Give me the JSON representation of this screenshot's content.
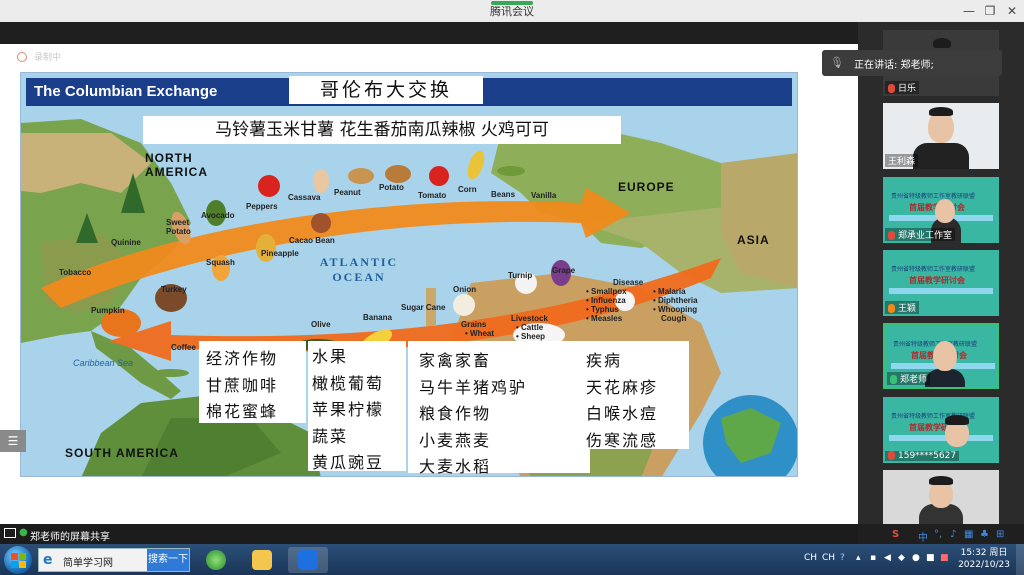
{
  "window": {
    "title": "腾讯会议",
    "controls": {
      "minimize": "—",
      "restore": "❐",
      "close": "✕"
    }
  },
  "share": {
    "recording_label": "录制中",
    "side_handle": "☰"
  },
  "slide": {
    "title_en": "The Columbian Exchange",
    "title_cn": "哥伦布大交换",
    "top_banner": "马铃薯玉米甘薯 花生番茄南瓜辣椒 火鸡可可",
    "regions": {
      "north_america": "NORTH AMERICA",
      "europe": "EUROPE",
      "asia": "ASIA",
      "south_america": "SOUTH AMERICA",
      "ocean": "ATLANTIC OCEAN",
      "sea": "Caribbean Sea"
    },
    "items": {
      "peppers": "Peppers",
      "cassava": "Cassava",
      "peanut": "Peanut",
      "potato": "Potato",
      "corn": "Corn",
      "tomato": "Tomato",
      "beans": "Beans",
      "vanilla": "Vanilla",
      "avocado": "Avocado",
      "sweet_potato": "Sweet Potato",
      "quinine": "Quinine",
      "cacao": "Cacao Bean",
      "squash": "Squash",
      "pineapple": "Pineapple",
      "tobacco": "Tobacco",
      "turkey": "Turkey",
      "pumpkin": "Pumpkin",
      "turnip": "Turnip",
      "grape": "Grape",
      "onion": "Onion",
      "sugar_cane": "Sugar Cane",
      "olive": "Olive",
      "banana": "Banana",
      "coffee": "Coffee",
      "grains": "Grains",
      "wheat": "• Wheat",
      "livestock": "Livestock",
      "cattle": "• Cattle",
      "sheep": "• Sheep",
      "disease": "Disease",
      "smallpox": "• Smallpox",
      "influenza": "• Influenza",
      "typhus": "• Typhus",
      "measles": "• Measles",
      "malaria": "• Malaria",
      "diphtheria": "• Diphtheria",
      "whooping": "• Whooping",
      "cough": "Cough"
    },
    "cn_lines": {
      "col1": [
        "经济作物",
        "甘蔗咖啡",
        "棉花蜜蜂"
      ],
      "col2": [
        "水果",
        "橄榄葡萄",
        "苹果柠檬",
        "蔬菜",
        "黄瓜豌豆"
      ],
      "col3": [
        "家禽家畜",
        "马牛羊猪鸡驴",
        "粮食作物",
        "小麦燕麦",
        "大麦水稻"
      ],
      "col4": [
        "疾病",
        "天花麻疹",
        "白喉水痘",
        "伤寒流感"
      ]
    }
  },
  "panel": {
    "speaking_label": "正在讲话: 郑老师;",
    "participants": [
      {
        "name": "日乐"
      },
      {
        "name": "王利森"
      },
      {
        "name": "郑承业工作室"
      },
      {
        "name": "王颖"
      },
      {
        "name": "郑老师"
      },
      {
        "name": "159****5627"
      },
      {
        "name": ""
      }
    ],
    "poster_line1": "贵州省特级教师工作室教研联盟",
    "poster_line2": "首届教学研讨会"
  },
  "statusbar": {
    "share_label": "郑老师的屏幕共享"
  },
  "taskbar": {
    "browser_name": "简单学习网",
    "search_button": "搜索一下",
    "tray_lang1": "CH",
    "tray_lang2": "CH",
    "time": "15:32 周日",
    "date": "2022/10/23"
  },
  "colors": {
    "header_blue": "#1a3e8a",
    "arrow_orange": "#f08a1c",
    "taskbar": "#1a3557"
  }
}
